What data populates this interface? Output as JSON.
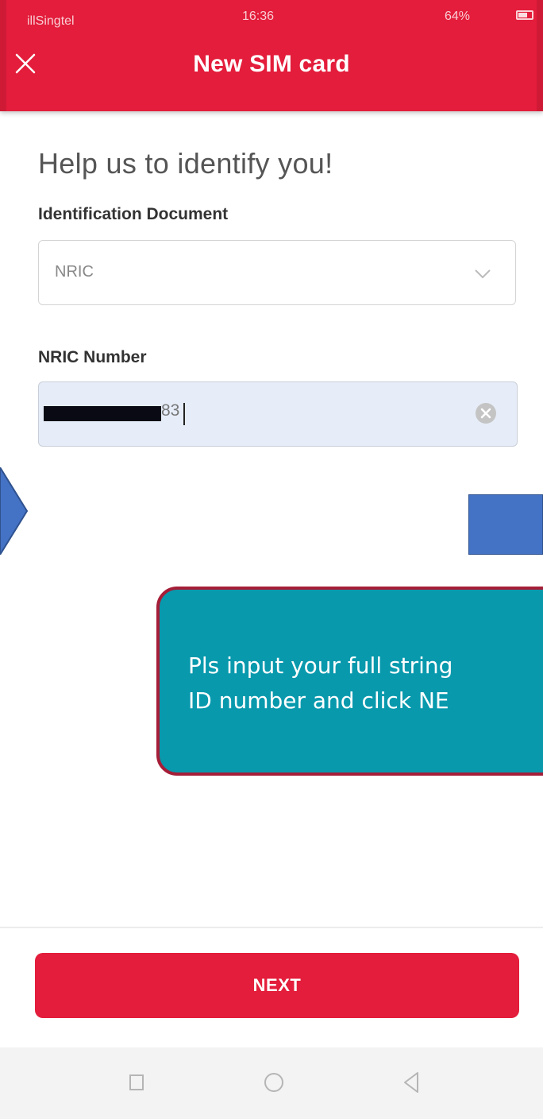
{
  "status_bar": {
    "carrier": "　illSingtel",
    "time": "16:36",
    "battery": "64%"
  },
  "header": {
    "title": "New SIM card",
    "close_icon": "close-icon"
  },
  "form": {
    "heading": "Help us to identify you!",
    "document_label": "Identification Document",
    "document_value": "NRIC",
    "number_label": "NRIC Number",
    "number_value_visible": "83"
  },
  "callout": {
    "line1": "Pls input your full string",
    "line2": "ID number and click NE"
  },
  "footer": {
    "next_label": "NEXT"
  },
  "colors": {
    "brand_red": "#e31d3b",
    "callout_teal": "#0899ad",
    "callout_border": "#a51e38",
    "shape_blue": "#4472c4"
  },
  "icons": [
    "close-icon",
    "chevron-down-icon",
    "clear-icon",
    "nav-recents-icon",
    "nav-home-icon",
    "nav-back-icon"
  ]
}
